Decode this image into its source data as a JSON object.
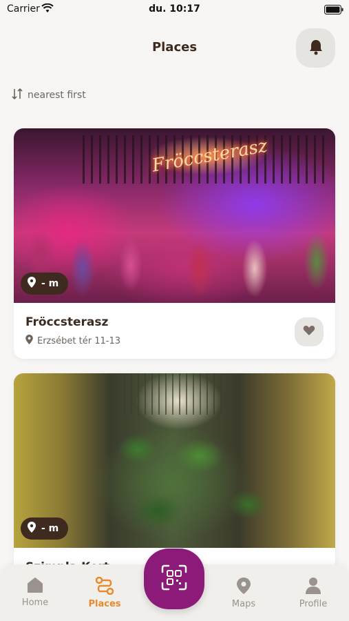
{
  "status_bar": {
    "carrier": "Carrier",
    "time": "du. 10:17"
  },
  "header": {
    "title": "Places"
  },
  "sort": {
    "label": "nearest first"
  },
  "places": [
    {
      "name": "Fröccsterasz",
      "address": "Erzsébet tér 11-13",
      "distance": "- m",
      "sign_text": "Fröccsterasz"
    },
    {
      "name": "Szimpla Kert",
      "address": "",
      "distance": "- m"
    }
  ],
  "tab_bar": {
    "tabs": [
      {
        "label": "Home",
        "icon": "home-icon"
      },
      {
        "label": "Places",
        "icon": "places-icon",
        "active": true
      },
      {
        "label": "Maps",
        "icon": "map-pin-icon"
      },
      {
        "label": "Profile",
        "icon": "profile-icon"
      }
    ]
  },
  "colors": {
    "accent": "#e88a2a",
    "primary": "#8c1a78",
    "brown": "#3e2a1e"
  }
}
